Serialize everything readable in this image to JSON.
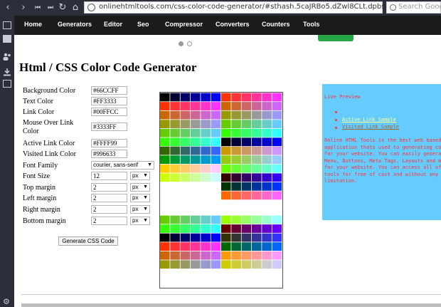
{
  "browser": {
    "url": "onlinehtmltools.com/css-color-code-generator/#sthash.5caJRBo5.dZwl8CLt.dpbs",
    "search_placeholder": "Search Google",
    "nav_icons": [
      "chevron-left-icon",
      "chevron-right-icon",
      "skip-back-icon",
      "skip-forward-icon",
      "reload-icon",
      "home-icon"
    ]
  },
  "sidebar": {
    "icons": [
      "window-icon",
      "mail-icon",
      "people-icon",
      "download-icon",
      "notes-icon",
      "gear-icon"
    ]
  },
  "site_nav": {
    "items": [
      "Home",
      "Generators",
      "Editor",
      "Seo",
      "Compressor",
      "Converters",
      "Counters",
      "Tools"
    ]
  },
  "page": {
    "title": "Html / CSS Color Code Generator"
  },
  "form": {
    "rows": [
      {
        "label": "Background Color",
        "value": "#66CCFF"
      },
      {
        "label": "Text Color",
        "value": "#FF3333"
      },
      {
        "label": "Link Color",
        "value": "#00FFCC"
      },
      {
        "label": "Mouse Over Link Color",
        "value": "#3333FF"
      },
      {
        "label": "Active Link Color",
        "value": "#FFFF99"
      },
      {
        "label": "Visited Link Color",
        "value": "#996633"
      }
    ],
    "font_family_label": "Font Family",
    "font_family_value": "courier, sans-serif",
    "size_rows": [
      {
        "label": "Font Size",
        "value": "12",
        "unit": "px"
      },
      {
        "label": "Top margin",
        "value": "2",
        "unit": "px"
      },
      {
        "label": "Left margin",
        "value": "2",
        "unit": "px"
      },
      {
        "label": "Right margin",
        "value": "2",
        "unit": "px"
      },
      {
        "label": "Bottom margin",
        "value": "2",
        "unit": "px"
      }
    ],
    "generate_label": "Generate CSS Code"
  },
  "preview": {
    "title": "Live Preview",
    "active_link": "Active Link Sample",
    "visited_link": "Visited Link Sample",
    "body": "Online HTML Tools is the best web based application thats used to generating codes for your website. You can easily generate Menu, Buttons, Meta Tags, Layouts and more for your website. You can access all of our tools for free of cost and without any limitation.",
    "bg_color": "#66ccff",
    "text_color": "#ff3333",
    "active_color": "#ffff99",
    "visited_color": "#996633"
  },
  "colors": {
    "browser_chrome": "#2b2f3a",
    "site_nav_bg": "#1b1b1b",
    "accent_green": "#27a844"
  }
}
